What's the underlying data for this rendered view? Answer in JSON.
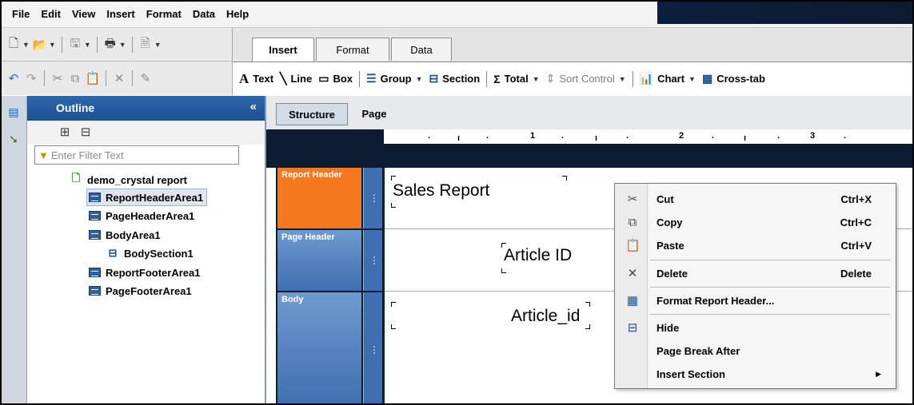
{
  "menubar": {
    "items": [
      "File",
      "Edit",
      "View",
      "Insert",
      "Format",
      "Data",
      "Help"
    ]
  },
  "tabs": [
    {
      "label": "Insert",
      "active": true
    },
    {
      "label": "Format",
      "active": false
    },
    {
      "label": "Data",
      "active": false
    }
  ],
  "insert_toolbar": {
    "text": "Text",
    "line": "Line",
    "box": "Box",
    "group": "Group",
    "section": "Section",
    "total": "Total",
    "sort": "Sort Control",
    "chart": "Chart",
    "crosstab": "Cross-tab"
  },
  "outline": {
    "title": "Outline",
    "collapse_glyph": "«",
    "filter_placeholder": "Enter Filter Text",
    "root": "demo_crystal report",
    "items": [
      "ReportHeaderArea1",
      "PageHeaderArea1",
      "BodyArea1",
      "BodySection1",
      "ReportFooterArea1",
      "PageFooterArea1"
    ],
    "selected": "ReportHeaderArea1"
  },
  "design_tabs": [
    {
      "label": "Structure",
      "active": true
    },
    {
      "label": "Page",
      "active": false
    }
  ],
  "ruler": {
    "numbers": [
      "1",
      "2",
      "3"
    ]
  },
  "sections": [
    {
      "label": "Report Header",
      "color": "#f5781e"
    },
    {
      "label": "Page Header",
      "color": "#4f7fbd"
    },
    {
      "label": "Body",
      "color": "#4f7fbd"
    }
  ],
  "fields": {
    "title": "Sales Report",
    "page_header": "Article ID",
    "body": "Article_id"
  },
  "context_menu": {
    "items": [
      {
        "label": "Cut",
        "shortcut": "Ctrl+X",
        "icon": "scissors-icon"
      },
      {
        "label": "Copy",
        "shortcut": "Ctrl+C",
        "icon": "copy-icon"
      },
      {
        "label": "Paste",
        "shortcut": "Ctrl+V",
        "icon": "paste-icon"
      },
      {
        "label": "Delete",
        "shortcut": "Delete",
        "icon": "delete-icon"
      },
      {
        "label": "Format Report Header...",
        "shortcut": "",
        "icon": "format-icon"
      },
      {
        "label": "Hide",
        "shortcut": "",
        "icon": "hide-icon"
      },
      {
        "label": "Page Break After",
        "shortcut": "",
        "icon": ""
      },
      {
        "label": "Insert Section",
        "shortcut": "",
        "icon": "",
        "submenu": true
      }
    ]
  },
  "colors": {
    "accent": "#1d4f94",
    "report_header": "#f5781e",
    "section_blue": "#4f7fbd",
    "dark": "#0e1c33"
  }
}
